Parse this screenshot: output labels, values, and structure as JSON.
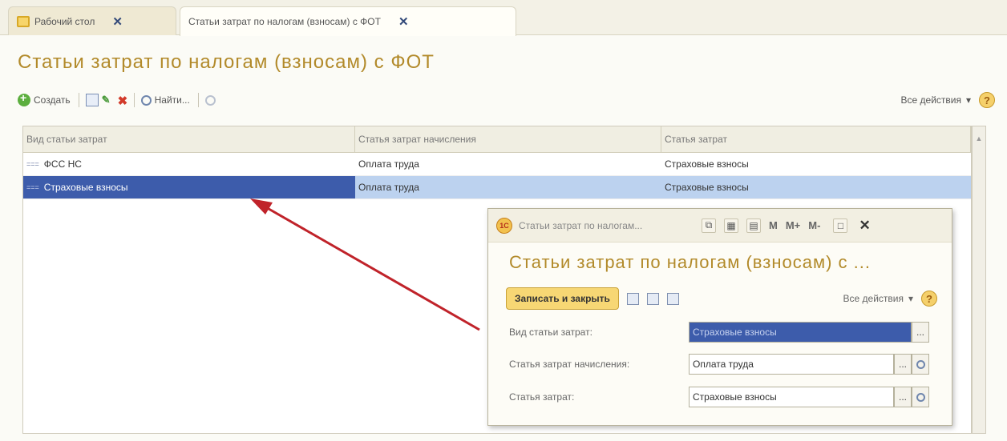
{
  "tabs": [
    {
      "label": "Рабочий стол",
      "close": "✕"
    },
    {
      "label": "Статьи затрат по налогам (взносам) с ФОТ",
      "close": "✕"
    }
  ],
  "page": {
    "title": "Статьи затрат по налогам (взносам) с ФОТ"
  },
  "toolbar": {
    "create_label": "Создать",
    "find_label": "Найти...",
    "all_actions_label": "Все действия",
    "all_actions_arrow": "▾",
    "help_label": "?"
  },
  "table": {
    "columns": [
      "Вид статьи затрат",
      "Статья затрат начисления",
      "Статья затрат"
    ],
    "rows": [
      {
        "icon": "===",
        "col1": "ФСС НС",
        "col2": "Оплата труда",
        "col3": "Страховые взносы"
      },
      {
        "icon": "===",
        "col1": "Страховые взносы",
        "col2": "Оплата труда",
        "col3": "Страховые взносы"
      }
    ]
  },
  "dialog": {
    "caption": "Статьи затрат по налогам...",
    "logo": "1С",
    "m_buttons": [
      "M",
      "M+",
      "M-"
    ],
    "close": "✕",
    "title": "Статьи затрат по налогам (взносам) с ...",
    "save_close_label": "Записать и закрыть",
    "all_actions_label": "Все действия",
    "all_actions_arrow": "▾",
    "help_label": "?",
    "fields": [
      {
        "label": "Вид статьи затрат:",
        "value": "Страховые взносы"
      },
      {
        "label": "Статья затрат начисления:",
        "value": "Оплата труда"
      },
      {
        "label": "Статья затрат:",
        "value": "Страховые взносы"
      }
    ],
    "ellipsis": "..."
  },
  "colors": {
    "accent": "#b28a2a",
    "selection": "#3d5cab",
    "arrow": "#c0232a"
  }
}
